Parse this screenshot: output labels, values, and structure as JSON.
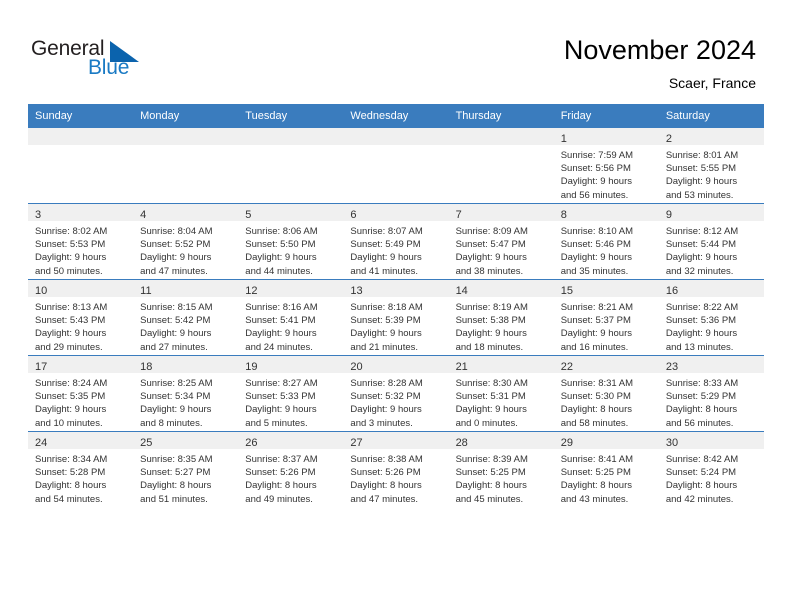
{
  "brand": {
    "word1": "General",
    "word2": "Blue",
    "triangle_color": "#0b63ad",
    "blue_color": "#1a7ac4"
  },
  "header": {
    "title": "November 2024",
    "subtitle": "Scaer, France",
    "accent_color": "#3a7cbe",
    "band_color": "#f0f0f0"
  },
  "weekdays": [
    "Sunday",
    "Monday",
    "Tuesday",
    "Wednesday",
    "Thursday",
    "Friday",
    "Saturday"
  ],
  "weeks": [
    [
      {
        "day": "",
        "sunrise": "",
        "sunset": "",
        "daylight1": "",
        "daylight2": ""
      },
      {
        "day": "",
        "sunrise": "",
        "sunset": "",
        "daylight1": "",
        "daylight2": ""
      },
      {
        "day": "",
        "sunrise": "",
        "sunset": "",
        "daylight1": "",
        "daylight2": ""
      },
      {
        "day": "",
        "sunrise": "",
        "sunset": "",
        "daylight1": "",
        "daylight2": ""
      },
      {
        "day": "",
        "sunrise": "",
        "sunset": "",
        "daylight1": "",
        "daylight2": ""
      },
      {
        "day": "1",
        "sunrise": "Sunrise: 7:59 AM",
        "sunset": "Sunset: 5:56 PM",
        "daylight1": "Daylight: 9 hours",
        "daylight2": "and 56 minutes."
      },
      {
        "day": "2",
        "sunrise": "Sunrise: 8:01 AM",
        "sunset": "Sunset: 5:55 PM",
        "daylight1": "Daylight: 9 hours",
        "daylight2": "and 53 minutes."
      }
    ],
    [
      {
        "day": "3",
        "sunrise": "Sunrise: 8:02 AM",
        "sunset": "Sunset: 5:53 PM",
        "daylight1": "Daylight: 9 hours",
        "daylight2": "and 50 minutes."
      },
      {
        "day": "4",
        "sunrise": "Sunrise: 8:04 AM",
        "sunset": "Sunset: 5:52 PM",
        "daylight1": "Daylight: 9 hours",
        "daylight2": "and 47 minutes."
      },
      {
        "day": "5",
        "sunrise": "Sunrise: 8:06 AM",
        "sunset": "Sunset: 5:50 PM",
        "daylight1": "Daylight: 9 hours",
        "daylight2": "and 44 minutes."
      },
      {
        "day": "6",
        "sunrise": "Sunrise: 8:07 AM",
        "sunset": "Sunset: 5:49 PM",
        "daylight1": "Daylight: 9 hours",
        "daylight2": "and 41 minutes."
      },
      {
        "day": "7",
        "sunrise": "Sunrise: 8:09 AM",
        "sunset": "Sunset: 5:47 PM",
        "daylight1": "Daylight: 9 hours",
        "daylight2": "and 38 minutes."
      },
      {
        "day": "8",
        "sunrise": "Sunrise: 8:10 AM",
        "sunset": "Sunset: 5:46 PM",
        "daylight1": "Daylight: 9 hours",
        "daylight2": "and 35 minutes."
      },
      {
        "day": "9",
        "sunrise": "Sunrise: 8:12 AM",
        "sunset": "Sunset: 5:44 PM",
        "daylight1": "Daylight: 9 hours",
        "daylight2": "and 32 minutes."
      }
    ],
    [
      {
        "day": "10",
        "sunrise": "Sunrise: 8:13 AM",
        "sunset": "Sunset: 5:43 PM",
        "daylight1": "Daylight: 9 hours",
        "daylight2": "and 29 minutes."
      },
      {
        "day": "11",
        "sunrise": "Sunrise: 8:15 AM",
        "sunset": "Sunset: 5:42 PM",
        "daylight1": "Daylight: 9 hours",
        "daylight2": "and 27 minutes."
      },
      {
        "day": "12",
        "sunrise": "Sunrise: 8:16 AM",
        "sunset": "Sunset: 5:41 PM",
        "daylight1": "Daylight: 9 hours",
        "daylight2": "and 24 minutes."
      },
      {
        "day": "13",
        "sunrise": "Sunrise: 8:18 AM",
        "sunset": "Sunset: 5:39 PM",
        "daylight1": "Daylight: 9 hours",
        "daylight2": "and 21 minutes."
      },
      {
        "day": "14",
        "sunrise": "Sunrise: 8:19 AM",
        "sunset": "Sunset: 5:38 PM",
        "daylight1": "Daylight: 9 hours",
        "daylight2": "and 18 minutes."
      },
      {
        "day": "15",
        "sunrise": "Sunrise: 8:21 AM",
        "sunset": "Sunset: 5:37 PM",
        "daylight1": "Daylight: 9 hours",
        "daylight2": "and 16 minutes."
      },
      {
        "day": "16",
        "sunrise": "Sunrise: 8:22 AM",
        "sunset": "Sunset: 5:36 PM",
        "daylight1": "Daylight: 9 hours",
        "daylight2": "and 13 minutes."
      }
    ],
    [
      {
        "day": "17",
        "sunrise": "Sunrise: 8:24 AM",
        "sunset": "Sunset: 5:35 PM",
        "daylight1": "Daylight: 9 hours",
        "daylight2": "and 10 minutes."
      },
      {
        "day": "18",
        "sunrise": "Sunrise: 8:25 AM",
        "sunset": "Sunset: 5:34 PM",
        "daylight1": "Daylight: 9 hours",
        "daylight2": "and 8 minutes."
      },
      {
        "day": "19",
        "sunrise": "Sunrise: 8:27 AM",
        "sunset": "Sunset: 5:33 PM",
        "daylight1": "Daylight: 9 hours",
        "daylight2": "and 5 minutes."
      },
      {
        "day": "20",
        "sunrise": "Sunrise: 8:28 AM",
        "sunset": "Sunset: 5:32 PM",
        "daylight1": "Daylight: 9 hours",
        "daylight2": "and 3 minutes."
      },
      {
        "day": "21",
        "sunrise": "Sunrise: 8:30 AM",
        "sunset": "Sunset: 5:31 PM",
        "daylight1": "Daylight: 9 hours",
        "daylight2": "and 0 minutes."
      },
      {
        "day": "22",
        "sunrise": "Sunrise: 8:31 AM",
        "sunset": "Sunset: 5:30 PM",
        "daylight1": "Daylight: 8 hours",
        "daylight2": "and 58 minutes."
      },
      {
        "day": "23",
        "sunrise": "Sunrise: 8:33 AM",
        "sunset": "Sunset: 5:29 PM",
        "daylight1": "Daylight: 8 hours",
        "daylight2": "and 56 minutes."
      }
    ],
    [
      {
        "day": "24",
        "sunrise": "Sunrise: 8:34 AM",
        "sunset": "Sunset: 5:28 PM",
        "daylight1": "Daylight: 8 hours",
        "daylight2": "and 54 minutes."
      },
      {
        "day": "25",
        "sunrise": "Sunrise: 8:35 AM",
        "sunset": "Sunset: 5:27 PM",
        "daylight1": "Daylight: 8 hours",
        "daylight2": "and 51 minutes."
      },
      {
        "day": "26",
        "sunrise": "Sunrise: 8:37 AM",
        "sunset": "Sunset: 5:26 PM",
        "daylight1": "Daylight: 8 hours",
        "daylight2": "and 49 minutes."
      },
      {
        "day": "27",
        "sunrise": "Sunrise: 8:38 AM",
        "sunset": "Sunset: 5:26 PM",
        "daylight1": "Daylight: 8 hours",
        "daylight2": "and 47 minutes."
      },
      {
        "day": "28",
        "sunrise": "Sunrise: 8:39 AM",
        "sunset": "Sunset: 5:25 PM",
        "daylight1": "Daylight: 8 hours",
        "daylight2": "and 45 minutes."
      },
      {
        "day": "29",
        "sunrise": "Sunrise: 8:41 AM",
        "sunset": "Sunset: 5:25 PM",
        "daylight1": "Daylight: 8 hours",
        "daylight2": "and 43 minutes."
      },
      {
        "day": "30",
        "sunrise": "Sunrise: 8:42 AM",
        "sunset": "Sunset: 5:24 PM",
        "daylight1": "Daylight: 8 hours",
        "daylight2": "and 42 minutes."
      }
    ]
  ]
}
